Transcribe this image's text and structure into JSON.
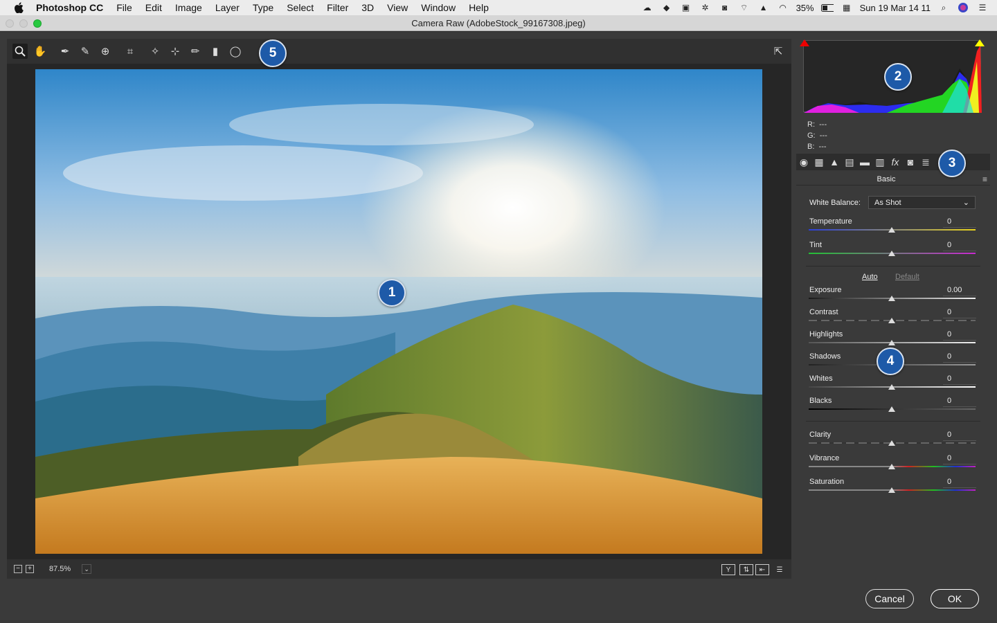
{
  "menubar": {
    "items": [
      "Photoshop CC",
      "File",
      "Edit",
      "Image",
      "Layer",
      "Type",
      "Select",
      "Filter",
      "3D",
      "View",
      "Window",
      "Help"
    ],
    "battery": "35%",
    "datetime": "Sun 19 Mar  14 11"
  },
  "window": {
    "title": "Camera Raw (AdobeStock_99167308.jpeg)"
  },
  "badges": {
    "b1": "1",
    "b2": "2",
    "b3": "3",
    "b4": "4",
    "b5": "5"
  },
  "statusbar": {
    "zoom": "87.5%"
  },
  "histogram": {
    "r_label": "R:",
    "g_label": "G:",
    "b_label": "B:",
    "r": "---",
    "g": "---",
    "b": "---"
  },
  "panel": {
    "name": "Basic",
    "white_balance_label": "White Balance:",
    "white_balance_value": "As Shot",
    "auto": "Auto",
    "default": "Default",
    "sliders": [
      {
        "label": "Temperature",
        "value": "0"
      },
      {
        "label": "Tint",
        "value": "0"
      },
      {
        "label": "Exposure",
        "value": "0.00"
      },
      {
        "label": "Contrast",
        "value": "0"
      },
      {
        "label": "Highlights",
        "value": "0"
      },
      {
        "label": "Shadows",
        "value": "0"
      },
      {
        "label": "Whites",
        "value": "0"
      },
      {
        "label": "Blacks",
        "value": "0"
      },
      {
        "label": "Clarity",
        "value": "0"
      },
      {
        "label": "Vibrance",
        "value": "0"
      },
      {
        "label": "Saturation",
        "value": "0"
      }
    ]
  },
  "footer": {
    "cancel": "Cancel",
    "ok": "OK"
  },
  "colors": {
    "accent": "#1e5aa8",
    "panel_bg": "#3a3a3a",
    "dark_bg": "#262626"
  }
}
